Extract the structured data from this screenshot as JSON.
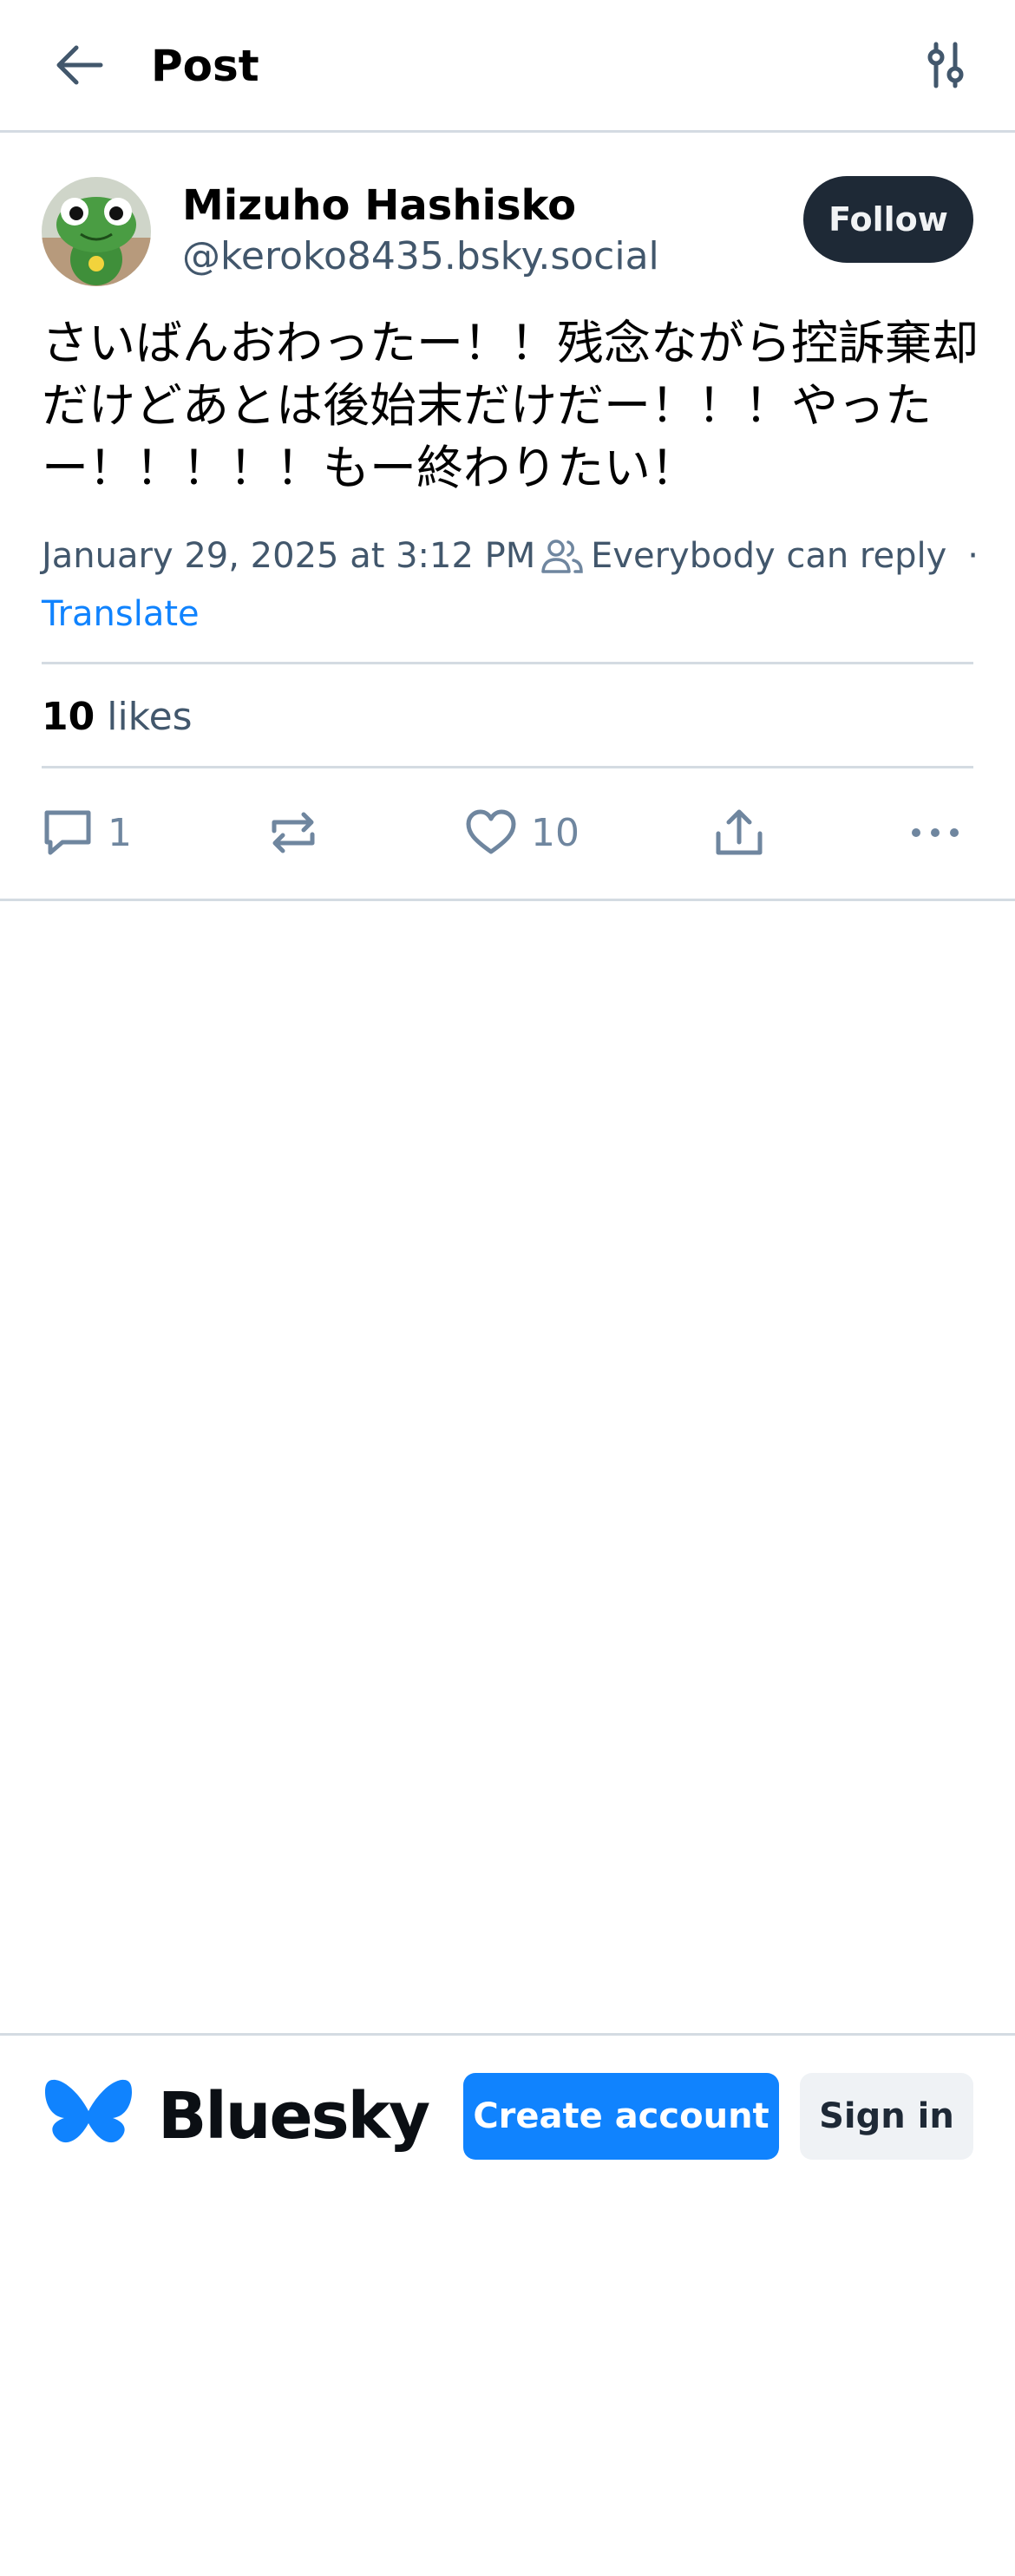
{
  "header": {
    "back_icon": "arrow-left-icon",
    "title": "Post",
    "filter_icon": "sliders-icon"
  },
  "author": {
    "name": "Mizuho Hashisko",
    "handle": "@keroko8435.bsky.social",
    "avatar": "green-frog-plush-avatar",
    "follow_label": "Follow"
  },
  "post": {
    "text": "さいばんおわったー！！残念ながら控訴棄却だけどあとは後始末だけだー！！！やったー！！！！！もー終わりたい！",
    "timestamp": "January 29, 2025 at 3:12 PM",
    "reply_setting": "Everybody can reply",
    "separator": "·",
    "translate_label": "Translate",
    "likes_count": "10",
    "likes_label": "likes"
  },
  "actions": {
    "reply_count": "1",
    "like_count": "10",
    "icons": [
      "comment-icon",
      "repost-icon",
      "heart-icon",
      "share-icon",
      "more-icon"
    ]
  },
  "footer": {
    "brand_name": "Bluesky",
    "create_account_label": "Create account",
    "sign_in_label": "Sign in"
  },
  "colors": {
    "accent": "#1083fe",
    "follow_bg": "#1e2936",
    "muted_text": "#42576c",
    "icon_gray": "#6f869f",
    "divider": "#d4dbe2"
  }
}
